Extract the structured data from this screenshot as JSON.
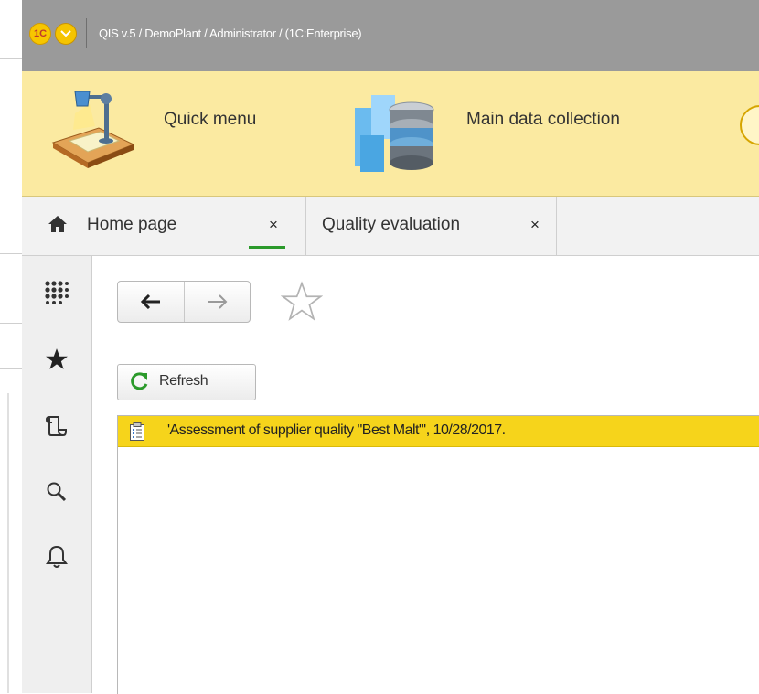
{
  "window": {
    "logo_text": "1C",
    "title": "QIS v.5 / DemoPlant / Administrator /  (1C:Enterprise)"
  },
  "toolbar": {
    "quick_menu_label": "Quick menu",
    "main_data_label": "Main data collection"
  },
  "tabs": {
    "home_label": "Home page",
    "home_close": "×",
    "quality_label": "Quality evaluation",
    "quality_close": "×"
  },
  "sidebar": {
    "icons": [
      "grid-icon",
      "favorites-star-icon",
      "history-icon",
      "search-icon",
      "bell-icon"
    ]
  },
  "content": {
    "refresh_label": "Refresh",
    "rows": [
      {
        "text": "'Assessment of supplier quality \"Best Malt\"',  10/28/2017."
      }
    ]
  },
  "colors": {
    "titlebar": "#9a9a9a",
    "toolbar": "#fbeaa1",
    "selected_row": "#f6d41b",
    "active_tab_underline": "#2b9a2b",
    "refresh_icon": "#2b9a2b"
  }
}
